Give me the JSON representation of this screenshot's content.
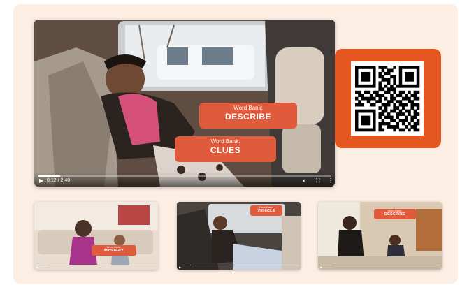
{
  "main_video": {
    "time": "0:12 / 2:40",
    "progress": 0.075,
    "bubbles": [
      {
        "line1": "Word Bank:",
        "line2": "DESCRIBE"
      },
      {
        "line1": "Word Bank:",
        "line2": "CLUES"
      }
    ]
  },
  "qr": {
    "rows": [
      "1111111011100101111111",
      "1000001001011001000001",
      "1011101010110001011101",
      "1011101011001101011101",
      "1011101001110101011101",
      "1000001010010101000001",
      "1111111010101011111111",
      "0000000011011100000000",
      "1101101100110101101011",
      "0110010111001011010110",
      "1011111010101100111011",
      "0100100110011011001100",
      "1110011001110101110111",
      "0000000010100110100101",
      "1111111001101101011010",
      "1000001011010011101011",
      "1011101010111010010110",
      "1011101001001101110101",
      "1011101011110010101011",
      "1000001010011110010110",
      "1111111011000101101011"
    ]
  },
  "thumbnails": [
    {
      "bubble_line1": "Word Bank:",
      "bubble_line2": "MYSTERY",
      "progress": 0.1
    },
    {
      "bubble_line1": "Word Bank:",
      "bubble_line2": "VEHICLE",
      "progress": 0.1
    },
    {
      "bubble_line1": "Word Bank:",
      "bubble_line2": "DESCRIBE",
      "progress": 0.1
    }
  ],
  "colors": {
    "panel": "#fdeee4",
    "accent": "#e3561f",
    "bubble": "#e05a3c"
  },
  "icons": [
    "play-icon",
    "volume-icon",
    "fullscreen-icon",
    "more-options-icon"
  ]
}
